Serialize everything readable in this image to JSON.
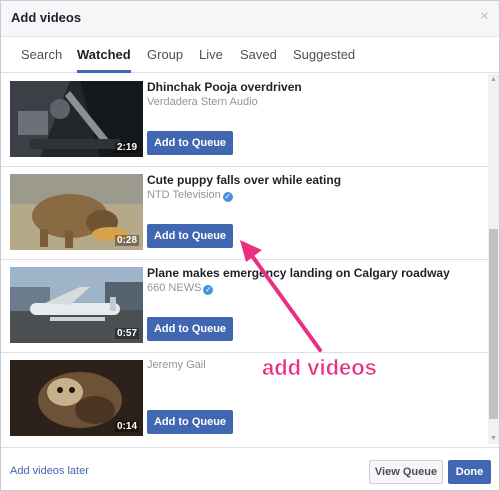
{
  "dialog": {
    "title": "Add videos",
    "close_icon": "close-icon",
    "close_glyph": "×"
  },
  "tabs": [
    {
      "label": "Search",
      "active": false
    },
    {
      "label": "Watched",
      "active": true
    },
    {
      "label": "Group",
      "active": false
    },
    {
      "label": "Live",
      "active": false
    },
    {
      "label": "Saved",
      "active": false
    },
    {
      "label": "Suggested",
      "active": false
    }
  ],
  "videos": [
    {
      "title": "Dhinchak Pooja overdriven",
      "source": "Verdadera Stern Audio",
      "verified": false,
      "duration": "2:19",
      "button": "Add to Queue",
      "thumbnail": "dark-scene-thumbnail"
    },
    {
      "title": "Cute puppy falls over while eating",
      "source": "NTD Television",
      "verified": true,
      "duration": "0:28",
      "button": "Add to Queue",
      "thumbnail": "puppy-thumbnail"
    },
    {
      "title": "Plane makes emergency landing on Calgary roadway",
      "source": "660 NEWS",
      "verified": true,
      "duration": "0:57",
      "button": "Add to Queue",
      "thumbnail": "airplane-thumbnail"
    },
    {
      "title": "",
      "source": "Jeremy Gail",
      "verified": false,
      "duration": "0:14",
      "button": "Add to Queue",
      "thumbnail": "cat-thumbnail"
    }
  ],
  "footer": {
    "later_link": "Add videos later",
    "view_queue": "View Queue",
    "done": "Done"
  },
  "annotation": {
    "text": "add videos",
    "color": "#ea2e80"
  },
  "colors": {
    "accent": "#4267b2",
    "verified": "#4a90e2"
  }
}
